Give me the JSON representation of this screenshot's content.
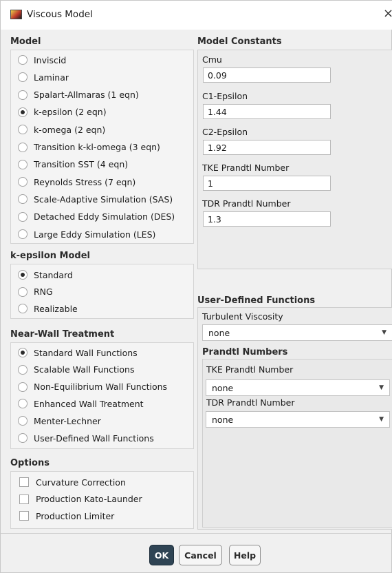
{
  "window": {
    "title": "Viscous Model",
    "close_symbol": "×"
  },
  "model": {
    "label": "Model",
    "options": [
      {
        "label": "Inviscid",
        "checked": false
      },
      {
        "label": "Laminar",
        "checked": false
      },
      {
        "label": "Spalart-Allmaras (1 eqn)",
        "checked": false
      },
      {
        "label": "k-epsilon (2 eqn)",
        "checked": true
      },
      {
        "label": "k-omega (2 eqn)",
        "checked": false
      },
      {
        "label": "Transition k-kl-omega (3 eqn)",
        "checked": false
      },
      {
        "label": "Transition SST (4 eqn)",
        "checked": false
      },
      {
        "label": "Reynolds Stress (7 eqn)",
        "checked": false
      },
      {
        "label": "Scale-Adaptive Simulation (SAS)",
        "checked": false
      },
      {
        "label": "Detached Eddy Simulation (DES)",
        "checked": false
      },
      {
        "label": "Large Eddy Simulation (LES)",
        "checked": false
      }
    ]
  },
  "kepsilon": {
    "label": "k-epsilon Model",
    "options": [
      {
        "label": "Standard",
        "checked": true
      },
      {
        "label": "RNG",
        "checked": false
      },
      {
        "label": "Realizable",
        "checked": false
      }
    ]
  },
  "near_wall": {
    "label": "Near-Wall Treatment",
    "options": [
      {
        "label": "Standard Wall Functions",
        "checked": true
      },
      {
        "label": "Scalable Wall Functions",
        "checked": false
      },
      {
        "label": "Non-Equilibrium Wall Functions",
        "checked": false
      },
      {
        "label": "Enhanced Wall Treatment",
        "checked": false
      },
      {
        "label": "Menter-Lechner",
        "checked": false
      },
      {
        "label": "User-Defined Wall Functions",
        "checked": false
      }
    ]
  },
  "options": {
    "label": "Options",
    "items": [
      {
        "label": "Curvature Correction",
        "checked": false
      },
      {
        "label": "Production Kato-Launder",
        "checked": false
      },
      {
        "label": "Production Limiter",
        "checked": false
      }
    ]
  },
  "constants": {
    "label": "Model Constants",
    "fields": [
      {
        "label": "Cmu",
        "value": "0.09"
      },
      {
        "label": "C1-Epsilon",
        "value": "1.44"
      },
      {
        "label": "C2-Epsilon",
        "value": "1.92"
      },
      {
        "label": "TKE Prandtl Number",
        "value": "1"
      },
      {
        "label": "TDR Prandtl Number",
        "value": "1.3"
      }
    ]
  },
  "udf": {
    "label": "User-Defined Functions",
    "turbulent_viscosity_label": "Turbulent Viscosity",
    "turbulent_viscosity_value": "none",
    "prandtl_label": "Prandtl Numbers",
    "tke_label": "TKE Prandtl Number",
    "tke_value": "none",
    "tdr_label": "TDR Prandtl Number",
    "tdr_value": "none"
  },
  "buttons": {
    "ok": "OK",
    "cancel": "Cancel",
    "help": "Help"
  },
  "icons": {
    "chevron": "▼",
    "app": "fluent-app-icon"
  }
}
